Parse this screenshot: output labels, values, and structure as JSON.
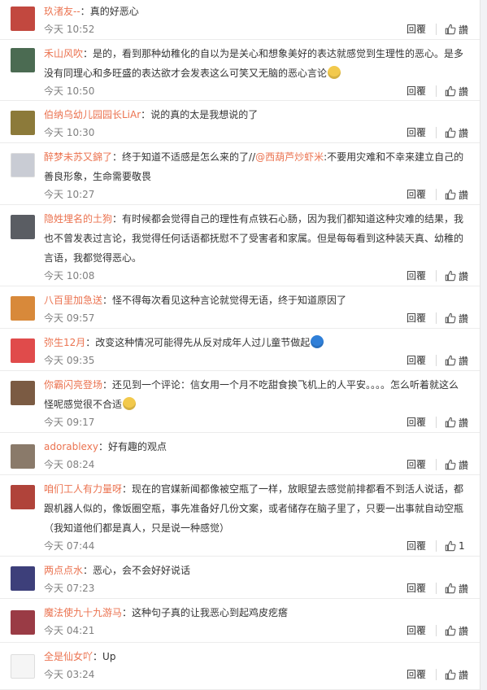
{
  "reply_label": "回覆",
  "like_label": "讚",
  "comments": [
    {
      "user": "玖渚友--",
      "text": "真的好恶心",
      "time": "今天 10:52",
      "likes": "讚",
      "avatar_color": "#c2483f"
    },
    {
      "user": "禾山风吹",
      "text": "是的，看到那种幼稚化的自以为是关心和想象美好的表达就感觉到生理性的恶心。是多没有同理心和多旺盛的表达欲才会发表这么可笑又无脑的恶心言论",
      "time": "今天 10:50",
      "likes": "讚",
      "avatar_color": "#4b6b52",
      "emoji": true
    },
    {
      "user": "伯纳乌幼儿园园长LiAr",
      "text": "说的真的太是我想说的了",
      "time": "今天 10:30",
      "likes": "讚",
      "avatar_color": "#8c7a3a"
    },
    {
      "user": "醉梦未苏又錦了",
      "text": "终于知道不适感是怎么来的了//",
      "mention": "@西葫芦炒虾米",
      "text2": ":不要用灾难和不幸来建立自己的善良形象，生命需要敬畏",
      "time": "今天 10:27",
      "likes": "讚",
      "avatar_color": "#c9ccd4"
    },
    {
      "user": "隐姓埋名的土狗",
      "text": "有时候都会觉得自己的理性有点铁石心肠，因为我们都知道这种灾难的结果，我也不曾发表过言论，我觉得任何话语都抚慰不了受害者和家属。但是每每看到这种装天真、幼稚的言语，我都觉得恶心。",
      "time": "今天 10:08",
      "likes": "讚",
      "avatar_color": "#5a5d63"
    },
    {
      "user": "八百里加急送",
      "text": "怪不得每次看见这种言论就觉得无语，终于知道原因了",
      "time": "今天 09:57",
      "likes": "讚",
      "avatar_color": "#d8893a"
    },
    {
      "user": "弥生12月",
      "text": "改变这种情况可能得先从反对成年人过儿童节做起",
      "time": "今天 09:35",
      "likes": "讚",
      "avatar_color": "#e04b4b",
      "emoji": true,
      "emoji_color": "#2f7fd8"
    },
    {
      "user": "你霸闪亮登场",
      "text": "还见到一个评论：信女用一个月不吃甜食换飞机上的人平安。。。。怎么听着就这么怪呢感觉很不合适",
      "time": "今天 09:17",
      "likes": "讚",
      "avatar_color": "#7b5b43",
      "emoji": true
    },
    {
      "user": "adorablexy",
      "text": "好有趣的观点",
      "time": "今天 08:24",
      "likes": "讚",
      "avatar_color": "#8a7a6a"
    },
    {
      "user": "咱们工人有力量呀",
      "text": "现在的官媒新闻都像被空瓶了一样，放眼望去感觉前排都看不到活人说话，都跟机器人似的，像饭圈空瓶，事先准备好几份文案，或者储存在脑子里了，只要一出事就自动空瓶（我知道他们都是真人，只是说一种感觉）",
      "time": "今天 07:44",
      "likes": "1",
      "avatar_color": "#b0433a"
    },
    {
      "user": "两点点水",
      "text": "恶心，会不会好好说话",
      "time": "今天 07:23",
      "likes": "讚",
      "avatar_color": "#3d3f7a"
    },
    {
      "user": "魔法使九十九游马",
      "text": "这种句子真的让我恶心到起鸡皮疙瘩",
      "time": "今天 04:21",
      "likes": "讚",
      "avatar_color": "#9a3b45"
    },
    {
      "user": "全是仙女吖",
      "text": "Up",
      "time": "今天 03:24",
      "likes": "讚",
      "avatar_color": "#f5f5f5"
    }
  ]
}
